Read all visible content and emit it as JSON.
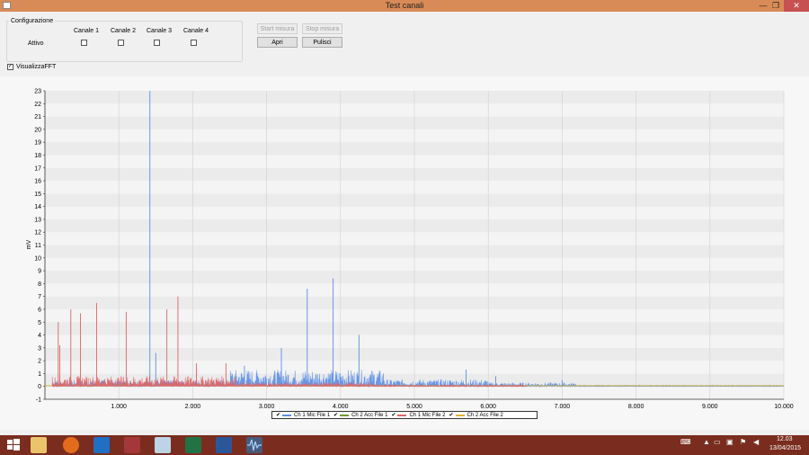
{
  "window": {
    "title": "Test canali"
  },
  "window_buttons": {
    "minimize": "—",
    "maximize": "❐",
    "close": "✕"
  },
  "config": {
    "group_label": "Configurazione",
    "row_label": "Attivo",
    "channels": [
      "Canale 1",
      "Canale 2",
      "Canale 3",
      "Canale 4"
    ]
  },
  "buttons": {
    "start": "Start misura",
    "stop": "Stop misura",
    "open": "Apri",
    "clear": "Pulisci"
  },
  "fft": {
    "label": "VisualizzaFFT",
    "checked": true
  },
  "chart_data": {
    "type": "line",
    "ylabel": "mV",
    "xlabel": "",
    "xlim": [
      0,
      10000
    ],
    "ylim": [
      -1,
      23
    ],
    "x_ticks": [
      "1.000",
      "2.000",
      "3.000",
      "4.000",
      "5.000",
      "6.000",
      "7.000",
      "8.000",
      "9.000",
      "10.000"
    ],
    "y_ticks": [
      "-1",
      "0",
      "1",
      "2",
      "3",
      "4",
      "5",
      "6",
      "7",
      "8",
      "9",
      "10",
      "11",
      "12",
      "13",
      "14",
      "15",
      "16",
      "17",
      "18",
      "19",
      "20",
      "21",
      "22",
      "23"
    ],
    "series": [
      {
        "name": "Ch 1 Mic File 1",
        "color": "#5b8ee6",
        "peaks": [
          [
            1420,
            23
          ],
          [
            3550,
            7.6
          ],
          [
            3900,
            8.4
          ],
          [
            4250,
            4.0
          ],
          [
            2700,
            1.6
          ],
          [
            3200,
            3.0
          ],
          [
            1500,
            2.6
          ],
          [
            5700,
            1.3
          ],
          [
            6100,
            0.8
          ],
          [
            7000,
            0.5
          ]
        ]
      },
      {
        "name": "Ch 2 Acc File 1",
        "color": "#6f9a2e",
        "peaks": []
      },
      {
        "name": "Ch 1 Mic File 2",
        "color": "#e06363",
        "peaks": [
          [
            180,
            5.0
          ],
          [
            350,
            6.0
          ],
          [
            480,
            5.7
          ],
          [
            700,
            6.5
          ],
          [
            1100,
            5.8
          ],
          [
            1650,
            6.0
          ],
          [
            1800,
            7.0
          ],
          [
            2050,
            1.8
          ],
          [
            2450,
            1.8
          ],
          [
            200,
            3.2
          ]
        ]
      },
      {
        "name": "Ch 2 Acc File 2",
        "color": "#e0b030",
        "peaks": []
      }
    ]
  },
  "legend": {
    "items": [
      "Ch 1 Mic File 1",
      "Ch 2 Acc File 1",
      "Ch 1 Mic File 2",
      "Ch 2 Acc File 2"
    ]
  },
  "taskbar": {
    "clock_time": "12.03",
    "clock_date": "13/04/2015",
    "apps": [
      "start-icon",
      "explorer-icon",
      "firefox-icon",
      "outlook-icon",
      "access-icon",
      "notepad-icon",
      "excel-icon",
      "word-icon",
      "waveform-app-icon"
    ]
  }
}
